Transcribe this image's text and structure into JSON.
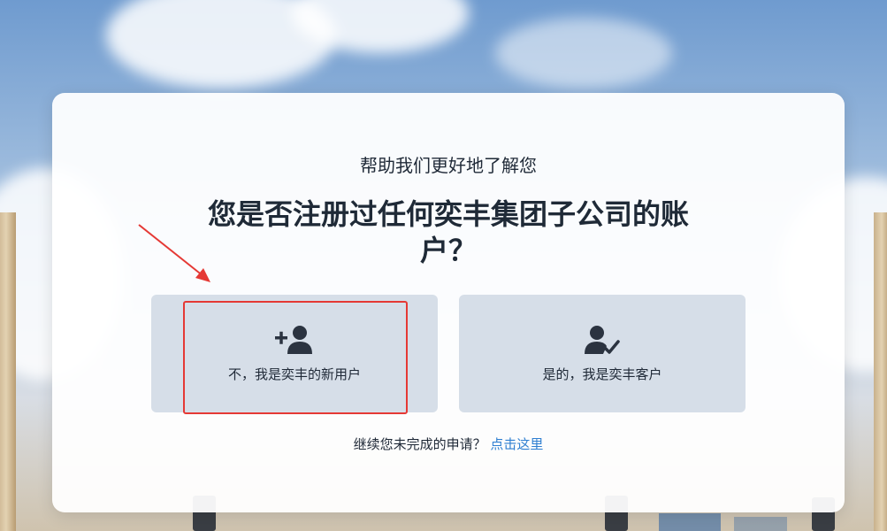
{
  "heading": {
    "subtitle": "帮助我们更好地了解您",
    "question": "您是否注册过任何奕丰集团子公司的账户？"
  },
  "options": {
    "new_user": {
      "label": "不，我是奕丰的新用户",
      "icon": "add-user-icon"
    },
    "existing_customer": {
      "label": "是的，我是奕丰客户",
      "icon": "user-check-icon"
    }
  },
  "footer": {
    "prompt": "继续您未完成的申请？",
    "link": "点击这里"
  },
  "colors": {
    "link": "#2f7fd1",
    "option_bg": "#d6dee8",
    "annotation": "#e53935"
  }
}
